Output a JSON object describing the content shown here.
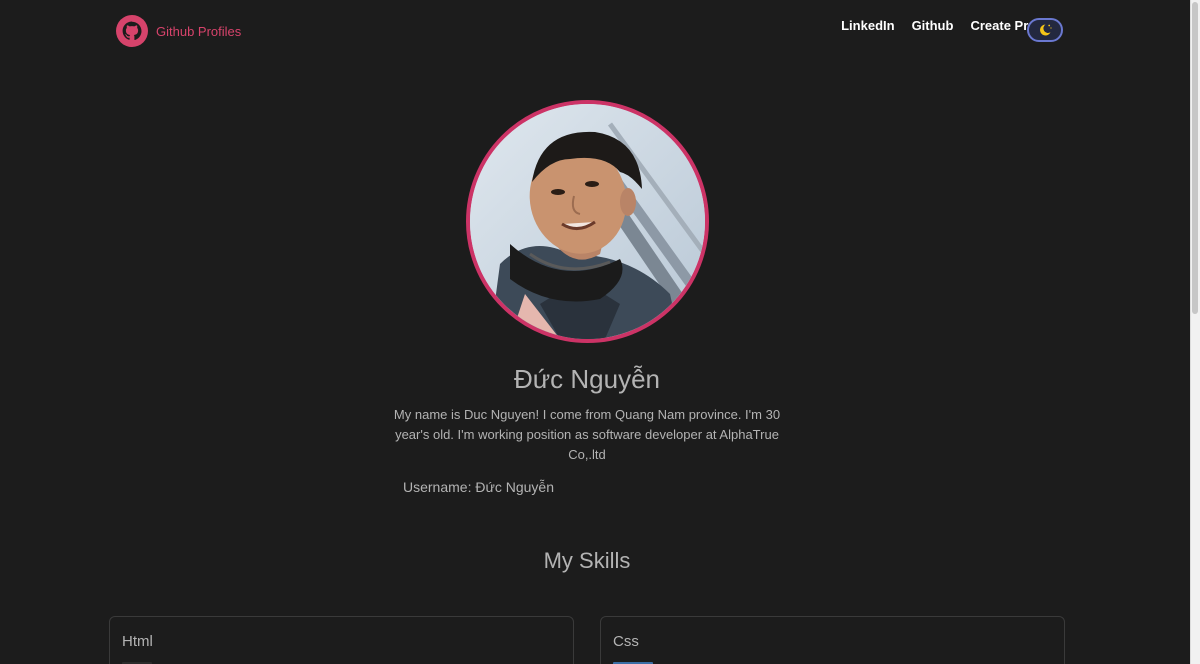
{
  "navbar": {
    "brand_label": "Github Profiles",
    "links": [
      "LinkedIn",
      "Github",
      "Create Profile"
    ],
    "theme_toggle_icon": "moon-icon"
  },
  "profile": {
    "name": "Đức Nguyễn",
    "bio": "My name is Duc Nguyen! I come from Quang Nam province. I'm 30 year's old. I'm working position as software developer at AlphaTrue Co,.ltd",
    "username": "Username: Đức Nguyễn",
    "avatar_icon": "profile-photo"
  },
  "skills": {
    "title": "My Skills",
    "items": [
      {
        "name": "Html"
      },
      {
        "name": "Css"
      }
    ]
  },
  "colors": {
    "accent": "#cc3366",
    "background": "#1c1c1c",
    "text": "#b3b3b3",
    "toggle_border": "#6a78d0"
  }
}
